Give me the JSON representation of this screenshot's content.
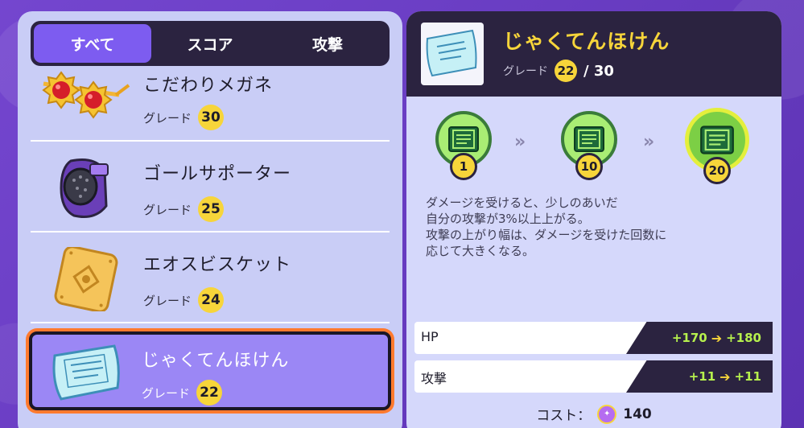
{
  "tabs": [
    {
      "label": "すべて",
      "active": true
    },
    {
      "label": "スコア",
      "active": false
    },
    {
      "label": "攻撃",
      "active": false
    }
  ],
  "items": [
    {
      "name": "こだわりメガネ",
      "grade_label": "グレード",
      "grade": "30",
      "icon": "choice-specs-icon"
    },
    {
      "name": "ゴールサポーター",
      "grade_label": "グレード",
      "grade": "25",
      "icon": "score-shield-icon"
    },
    {
      "name": "エオスビスケット",
      "grade_label": "グレード",
      "grade": "24",
      "icon": "aeos-cookie-icon"
    },
    {
      "name": "じゃくてんほけん",
      "grade_label": "グレード",
      "grade": "22",
      "icon": "weakness-policy-icon",
      "selected": true
    }
  ],
  "detail": {
    "title": "じゃくてんほけん",
    "grade_label": "グレード",
    "grade": "22",
    "grade_max": "/ 30",
    "icon": "weakness-policy-icon",
    "levels": [
      "1",
      "10",
      "20"
    ],
    "description": [
      "ダメージを受けると、少しのあいだ",
      "自分の攻撃が3%以上上がる。",
      "攻撃の上がり幅は、ダメージを受けた回数に",
      "応じて大きくなる。"
    ],
    "stats": [
      {
        "label": "HP",
        "from": "+170",
        "to": "+180"
      },
      {
        "label": "攻撃",
        "from": "+11",
        "to": "+11"
      }
    ],
    "cost_label": "コスト：",
    "cost_value": "140",
    "cost_icon": "item-enhancer-icon"
  },
  "colors": {
    "accent": "#7d5cf0",
    "grade_badge": "#f7d53a",
    "highlight": "#ff7a2e",
    "stat_green": "#b6f04d"
  }
}
